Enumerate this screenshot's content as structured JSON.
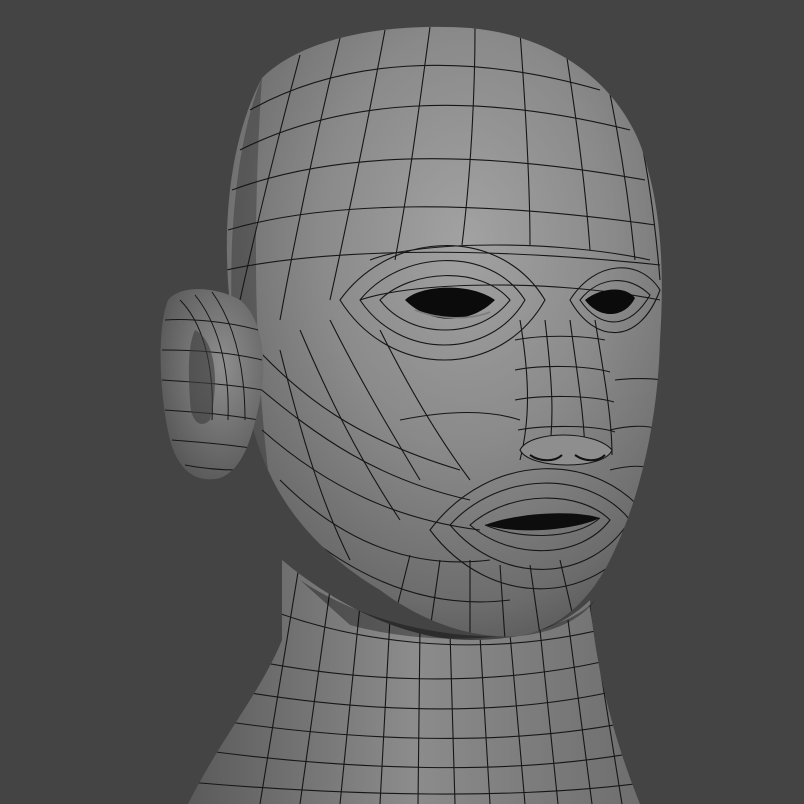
{
  "viewport": {
    "background_color": "#444444",
    "subject": "head-mesh",
    "display_mode": "wireframe-on-shaded",
    "shading": "grey-smooth",
    "colors": {
      "skin_light": "#9a9a9a",
      "skin_mid": "#7a7a7a",
      "skin_dark": "#4a4a4a",
      "wireframe": "#161616",
      "cavity": "#0b0b0b"
    }
  }
}
